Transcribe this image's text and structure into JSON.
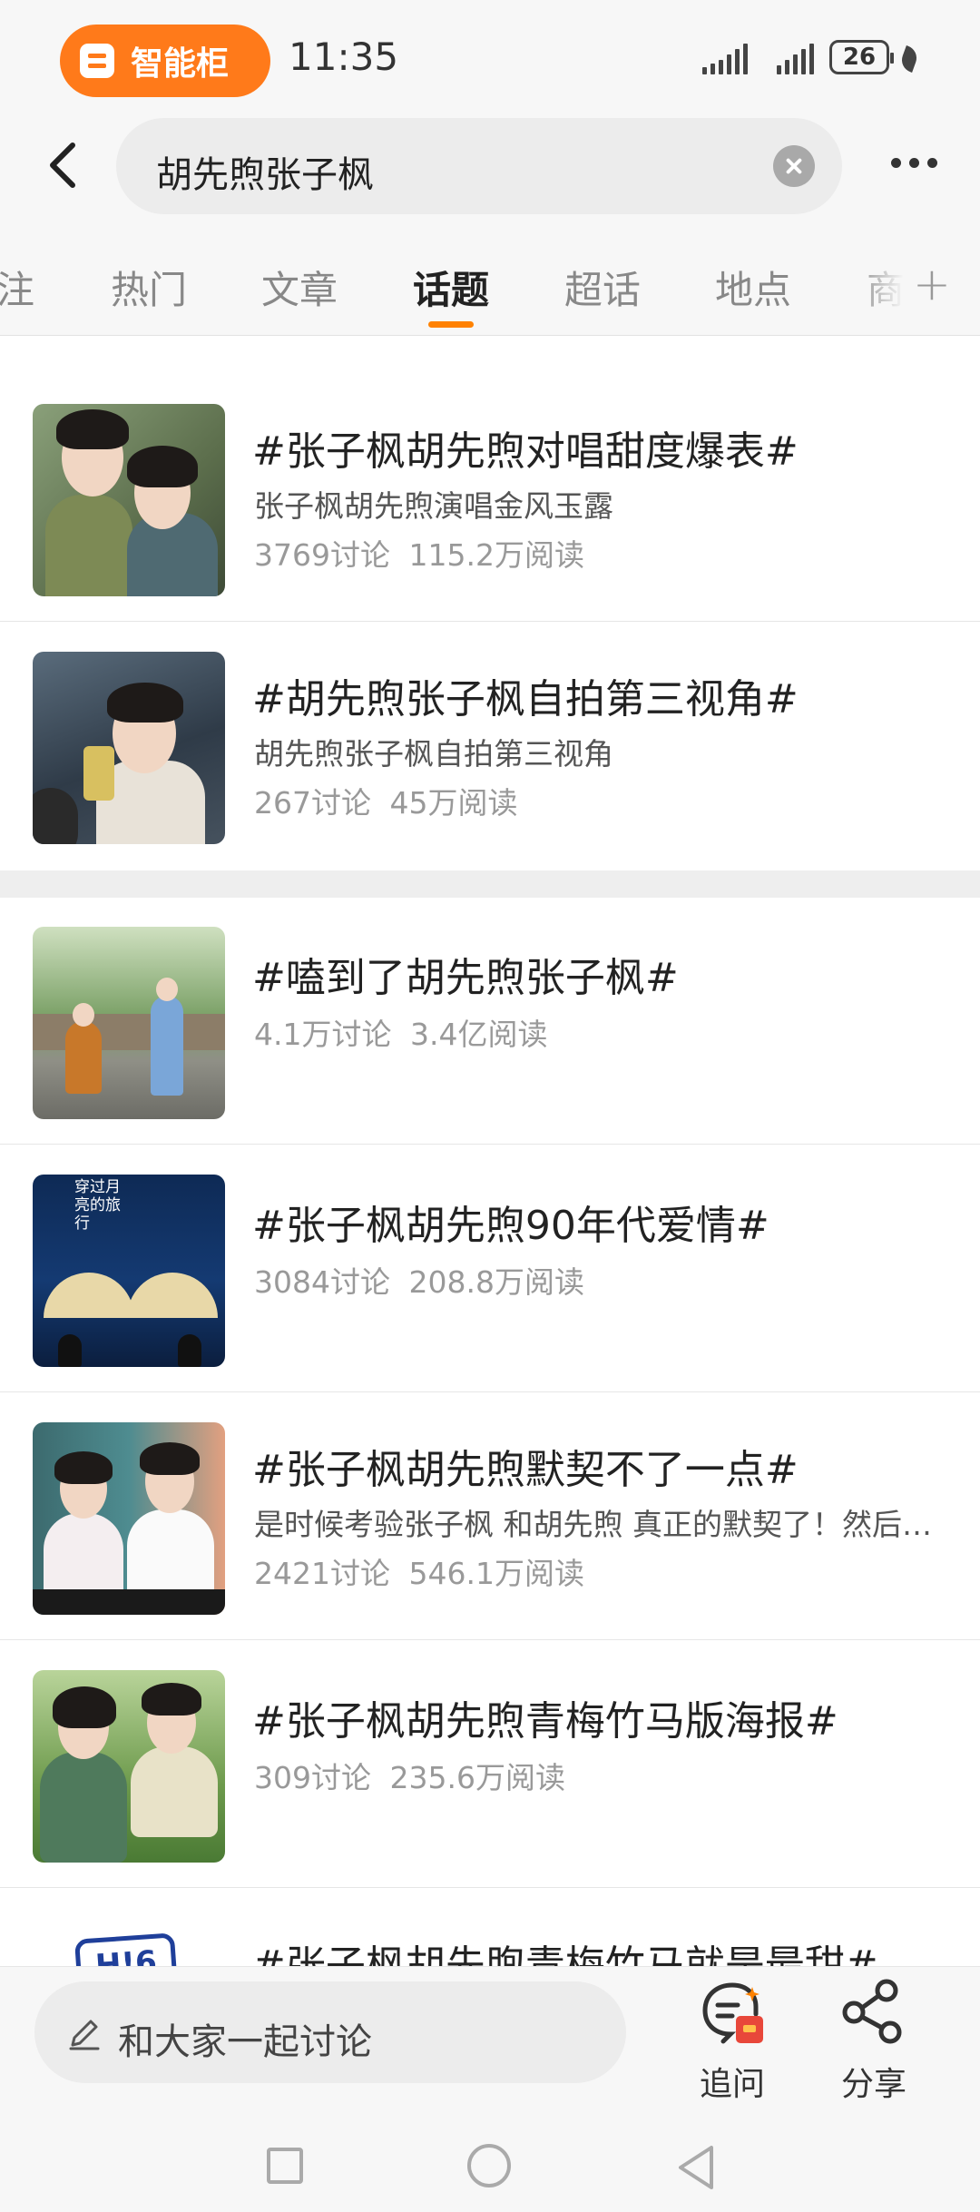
{
  "status_bar": {
    "pill_label": "智能柜",
    "time": "11:35",
    "battery": "26",
    "accent": "#ff7a1a"
  },
  "search": {
    "query": "胡先煦张子枫"
  },
  "tabs": [
    {
      "label": "注"
    },
    {
      "label": "热门"
    },
    {
      "label": "文章"
    },
    {
      "label": "话题",
      "active": true
    },
    {
      "label": "超话"
    },
    {
      "label": "地点"
    },
    {
      "label": "商"
    }
  ],
  "topics": [
    {
      "title": "#张子枫胡先煦对唱甜度爆表#",
      "desc": "张子枫胡先煦演唱金风玉露",
      "discuss": "3769讨论",
      "reads": "115.2万阅读"
    },
    {
      "title": "#胡先煦张子枫自拍第三视角#",
      "desc": "胡先煦张子枫自拍第三视角",
      "discuss": "267讨论",
      "reads": "45万阅读"
    },
    {
      "title": "#嗑到了胡先煦张子枫#",
      "desc": "",
      "discuss": "4.1万讨论",
      "reads": "3.4亿阅读"
    },
    {
      "title": "#张子枫胡先煦90年代爱情#",
      "desc": "",
      "discuss": "3084讨论",
      "reads": "208.8万阅读"
    },
    {
      "title": "#张子枫胡先煦默契不了一点#",
      "desc": "是时候考验张子枫 和胡先煦 真正的默契了！然后……",
      "discuss": "2421讨论",
      "reads": "546.1万阅读"
    },
    {
      "title": "#张子枫胡先煦青梅竹马版海报#",
      "desc": "",
      "discuss": "309讨论",
      "reads": "235.6万阅读"
    },
    {
      "title": "#张子枫胡先煦青梅竹马就是最甜#",
      "desc": "",
      "discuss": "",
      "reads": ""
    }
  ],
  "thumb_badges": {
    "poster_text": "穿过月亮的旅行",
    "h6_logo": "H!6"
  },
  "bottom_bar": {
    "compose_placeholder": "和大家一起讨论",
    "ask_label": "追问",
    "share_label": "分享"
  },
  "icons": {
    "back": "chevron-left-icon",
    "clear": "clear-icon",
    "more": "more-icon",
    "add_tab": "plus-icon",
    "compose": "pencil-icon",
    "ask": "ask-icon",
    "share": "share-icon"
  }
}
